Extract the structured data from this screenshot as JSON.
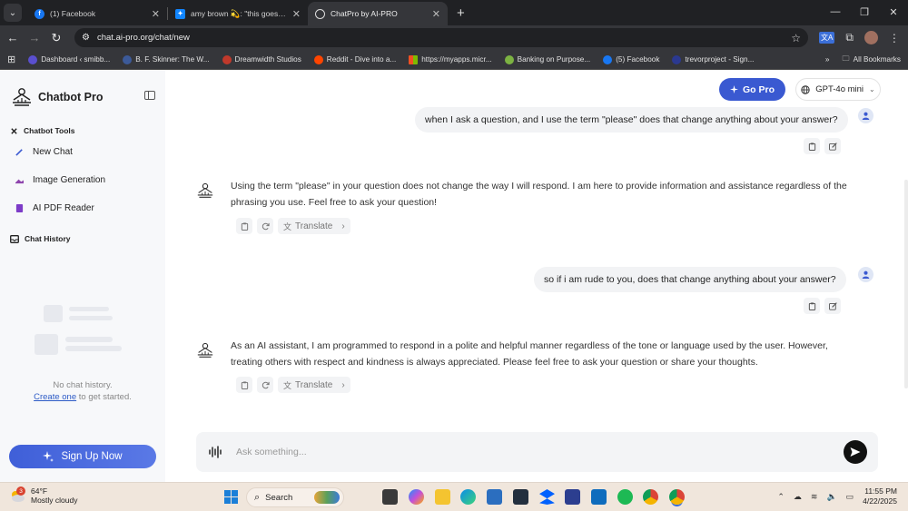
{
  "browser": {
    "tabs": [
      {
        "title": "(1) Facebook",
        "active": false
      },
      {
        "title": "amy brown 💫: \"this goes on fo",
        "active": false
      },
      {
        "title": "ChatPro by AI-PRO",
        "active": true
      }
    ],
    "url": "chat.ai-pro.org/chat/new",
    "bookmarks": [
      "Dashboard ‹ smibb...",
      "B. F. Skinner: The W...",
      "Dreamwidth Studios",
      "Reddit - Dive into a...",
      "https://myapps.micr...",
      "Banking on Purpose...",
      "(5) Facebook",
      "trevorproject - Sign..."
    ],
    "all_bookmarks": "All Bookmarks",
    "colors": {
      "frame": "#202124",
      "toolbar": "#35363a"
    }
  },
  "sidebar": {
    "brand": "Chatbot Pro",
    "tools_heading": "Chatbot Tools",
    "items": [
      {
        "label": "New Chat",
        "icon": "pencil-icon"
      },
      {
        "label": "Image Generation",
        "icon": "image-icon"
      },
      {
        "label": "AI PDF Reader",
        "icon": "pdf-icon"
      }
    ],
    "history_heading": "Chat History",
    "empty_line1": "No chat history.",
    "create_link": "Create one",
    "empty_line2": " to get started.",
    "signup_label": "Sign Up Now"
  },
  "header": {
    "gopro_label": "Go Pro",
    "model_label": "GPT-4o mini"
  },
  "conversation": [
    {
      "role": "user",
      "text": "when I ask a question, and I use the term \"please\" does that change anything about your answer?"
    },
    {
      "role": "assistant",
      "text": "Using the term \"please\" in your question does not change the way I will respond. I am here to provide information and assistance regardless of the phrasing you use. Feel free to ask your question!"
    },
    {
      "role": "user",
      "text": "so if i am rude to you, does that change anything about your answer?"
    },
    {
      "role": "assistant",
      "text": "As an AI assistant, I am programmed to respond in a polite and helpful manner regardless of the tone or language used by the user. However, treating others with respect and kindness is always appreciated. Please feel free to ask your question or share your thoughts."
    }
  ],
  "translate_label": "Translate",
  "composer": {
    "placeholder": "Ask something..."
  },
  "accent_color": "#3a59d1",
  "taskbar": {
    "weather_badge": "3",
    "temperature": "64°F",
    "condition": "Mostly cloudy",
    "search_label": "Search",
    "time": "11:55 PM",
    "date": "4/22/2025"
  }
}
